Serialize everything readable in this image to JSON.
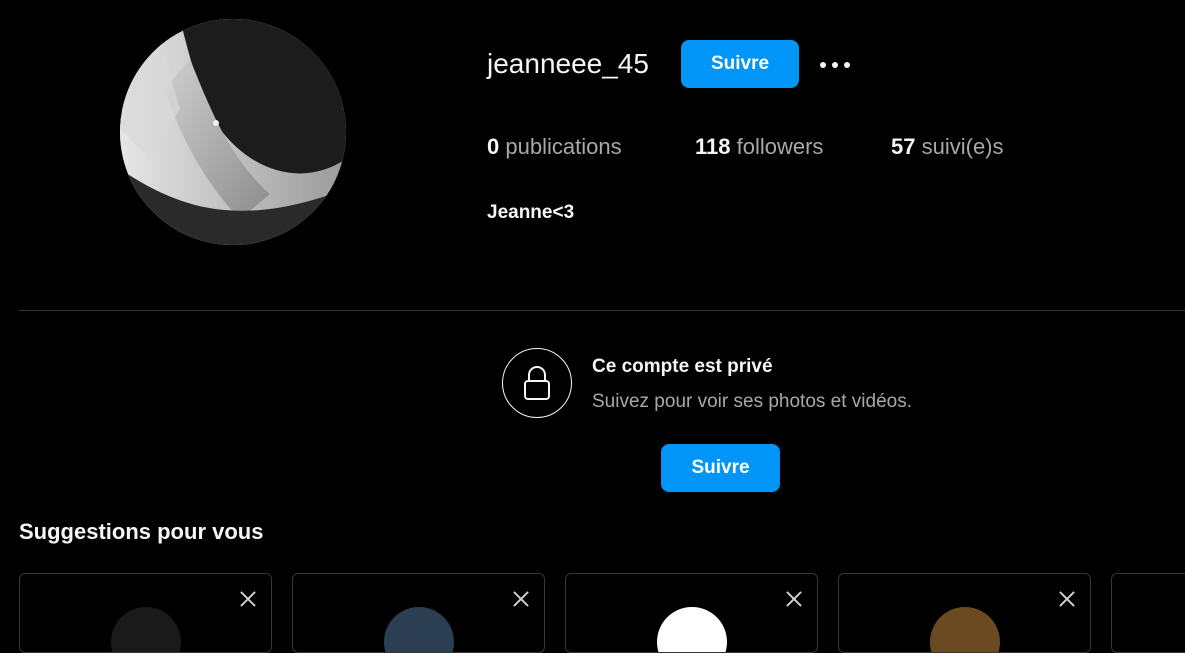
{
  "profile": {
    "username": "jeanneee_45",
    "follow_label": "Suivre",
    "more_icon": "more-options-icon",
    "stats": {
      "posts_count": "0",
      "posts_label": "publications",
      "followers_count": "118",
      "followers_label": "followers",
      "following_count": "57",
      "following_label": "suivi(e)s"
    },
    "bio_name": "Jeanne<3"
  },
  "private_notice": {
    "icon": "lock-icon",
    "title": "Ce compte est privé",
    "subtitle": "Suivez pour voir ses photos et vidéos.",
    "follow_label": "Suivre"
  },
  "suggestions": {
    "title": "Suggestions pour vous",
    "dismiss_icon": "close-icon",
    "cards": [
      {
        "avatar_color": "#1a1a1a"
      },
      {
        "avatar_color": "#2c3f52"
      },
      {
        "avatar_color": "#ffffff"
      },
      {
        "avatar_color": "#6b4a22"
      },
      {
        "avatar_color": "#333333"
      }
    ]
  },
  "colors": {
    "background": "#000000",
    "accent": "#0095f6",
    "text_primary": "#f5f5f5",
    "text_secondary": "#a8a8a8",
    "border": "#363636"
  }
}
